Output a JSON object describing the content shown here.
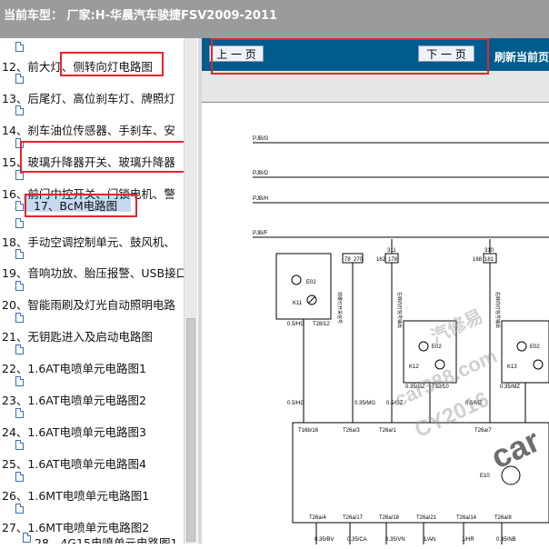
{
  "header": {
    "title": "当前车型： 厂家:H-华晨汽车骏捷FSV2009-2011"
  },
  "sidebar": {
    "items": [
      {
        "label": "12、前大灯、侧转向灯电路图"
      },
      {
        "label": "13、后尾灯、高位刹车灯、牌照灯"
      },
      {
        "label": "14、刹车油位传感器、手刹车、安"
      },
      {
        "label": "15、玻璃升降器开关、玻璃升降器"
      },
      {
        "label": "16、前门中控开关、门锁电机、警"
      },
      {
        "label": "17、BcM电路图"
      },
      {
        "label": "18、手动空调控制单元、鼓风机、"
      },
      {
        "label": "19、音响功放、胎压报警、USB接口"
      },
      {
        "label": "20、智能雨刷及灯光自动照明电路"
      },
      {
        "label": "21、无钥匙进入及启动电路图"
      },
      {
        "label": "22、1.6AT电喷单元电路图1"
      },
      {
        "label": "23、1.6AT电喷单元电路图2"
      },
      {
        "label": "24、1.6AT电喷单元电路图3"
      },
      {
        "label": "25、1.6AT电喷单元电路图4"
      },
      {
        "label": "26、1.6MT电喷单元电路图1"
      },
      {
        "label": "27、1.6MT电喷单元电路图2"
      },
      {
        "label": "28、4G15电喷单元电路图1"
      }
    ]
  },
  "toolbar": {
    "prev_label": "上 一 页",
    "next_label": "下 一 页",
    "refresh_label": "刷新当前页"
  },
  "diagram": {
    "bus_labels": [
      "PJB/G",
      "PJB/D",
      "PJB/H",
      "PJB/F"
    ],
    "fuse_labels": [
      "78",
      "270",
      "162",
      "178",
      "311",
      "168",
      "181",
      "310"
    ],
    "relay_labels": [
      "E02",
      "K11",
      "E02",
      "K12",
      "E02",
      "K13",
      "E10"
    ],
    "vertical_labels": [
      "前雾灯开关信号",
      "左转向灯信号输出",
      "右转向灯信号输出"
    ],
    "wire_labels": [
      "0.5/HG",
      "T28/12",
      "0.35/GZ",
      "T32/10",
      "0.35/MZ",
      "0.5/HG",
      "0.35/MG",
      "0.5/GZ",
      "0.5/MZ"
    ],
    "connector_labels": [
      "T16b/16",
      "T26a/3",
      "T26a/1",
      "T26a/7",
      "T26a/4",
      "T26a/17",
      "T26a/18",
      "T26a/21",
      "T26a/14",
      "T26a/8"
    ],
    "bottom_wires": [
      "0.35/BV",
      "0.35/CA",
      "0.35/VN",
      "1/AN",
      "1/HR",
      "0.35/NB"
    ]
  },
  "watermarks": [
    "汽修易",
    "car388.com",
    "CY2016",
    "car"
  ]
}
